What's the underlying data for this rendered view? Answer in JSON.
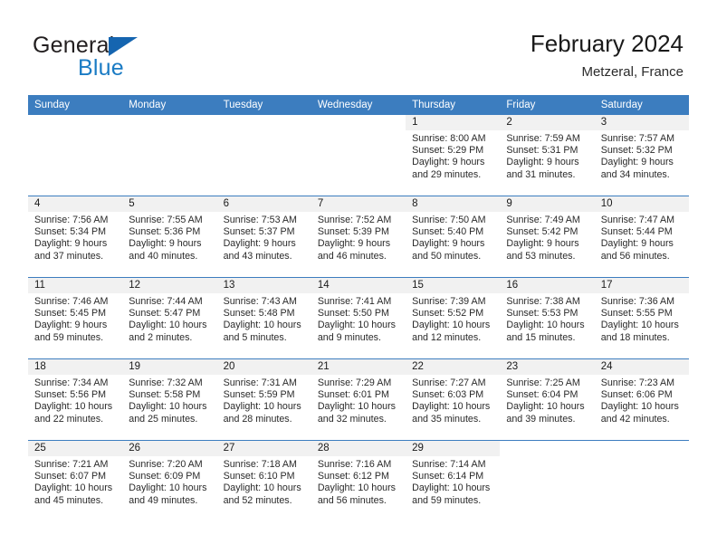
{
  "brand": {
    "name_top": "General",
    "name_bottom": "Blue",
    "triangle_icon": "blue-triangle-logo-icon",
    "color_dark": "#231f20",
    "color_blue": "#1a7bc4"
  },
  "header": {
    "title": "February 2024",
    "subtitle": "Metzeral, France"
  },
  "theme": {
    "header_row_bg": "#3c7dbf",
    "daynum_band_bg": "#f1f1f1",
    "week_separator": "#3c7dbf",
    "text": "#2a2a2a"
  },
  "weekday_headers": [
    "Sunday",
    "Monday",
    "Tuesday",
    "Wednesday",
    "Thursday",
    "Friday",
    "Saturday"
  ],
  "weeks": [
    [
      {
        "day": "",
        "blank": true,
        "sunrise": "",
        "sunset": "",
        "daylight_line1": "",
        "daylight_line2": ""
      },
      {
        "day": "",
        "blank": true,
        "sunrise": "",
        "sunset": "",
        "daylight_line1": "",
        "daylight_line2": ""
      },
      {
        "day": "",
        "blank": true,
        "sunrise": "",
        "sunset": "",
        "daylight_line1": "",
        "daylight_line2": ""
      },
      {
        "day": "",
        "blank": true,
        "sunrise": "",
        "sunset": "",
        "daylight_line1": "",
        "daylight_line2": ""
      },
      {
        "day": "1",
        "blank": false,
        "sunrise": "Sunrise: 8:00 AM",
        "sunset": "Sunset: 5:29 PM",
        "daylight_line1": "Daylight: 9 hours",
        "daylight_line2": "and 29 minutes."
      },
      {
        "day": "2",
        "blank": false,
        "sunrise": "Sunrise: 7:59 AM",
        "sunset": "Sunset: 5:31 PM",
        "daylight_line1": "Daylight: 9 hours",
        "daylight_line2": "and 31 minutes."
      },
      {
        "day": "3",
        "blank": false,
        "sunrise": "Sunrise: 7:57 AM",
        "sunset": "Sunset: 5:32 PM",
        "daylight_line1": "Daylight: 9 hours",
        "daylight_line2": "and 34 minutes."
      }
    ],
    [
      {
        "day": "4",
        "blank": false,
        "sunrise": "Sunrise: 7:56 AM",
        "sunset": "Sunset: 5:34 PM",
        "daylight_line1": "Daylight: 9 hours",
        "daylight_line2": "and 37 minutes."
      },
      {
        "day": "5",
        "blank": false,
        "sunrise": "Sunrise: 7:55 AM",
        "sunset": "Sunset: 5:36 PM",
        "daylight_line1": "Daylight: 9 hours",
        "daylight_line2": "and 40 minutes."
      },
      {
        "day": "6",
        "blank": false,
        "sunrise": "Sunrise: 7:53 AM",
        "sunset": "Sunset: 5:37 PM",
        "daylight_line1": "Daylight: 9 hours",
        "daylight_line2": "and 43 minutes."
      },
      {
        "day": "7",
        "blank": false,
        "sunrise": "Sunrise: 7:52 AM",
        "sunset": "Sunset: 5:39 PM",
        "daylight_line1": "Daylight: 9 hours",
        "daylight_line2": "and 46 minutes."
      },
      {
        "day": "8",
        "blank": false,
        "sunrise": "Sunrise: 7:50 AM",
        "sunset": "Sunset: 5:40 PM",
        "daylight_line1": "Daylight: 9 hours",
        "daylight_line2": "and 50 minutes."
      },
      {
        "day": "9",
        "blank": false,
        "sunrise": "Sunrise: 7:49 AM",
        "sunset": "Sunset: 5:42 PM",
        "daylight_line1": "Daylight: 9 hours",
        "daylight_line2": "and 53 minutes."
      },
      {
        "day": "10",
        "blank": false,
        "sunrise": "Sunrise: 7:47 AM",
        "sunset": "Sunset: 5:44 PM",
        "daylight_line1": "Daylight: 9 hours",
        "daylight_line2": "and 56 minutes."
      }
    ],
    [
      {
        "day": "11",
        "blank": false,
        "sunrise": "Sunrise: 7:46 AM",
        "sunset": "Sunset: 5:45 PM",
        "daylight_line1": "Daylight: 9 hours",
        "daylight_line2": "and 59 minutes."
      },
      {
        "day": "12",
        "blank": false,
        "sunrise": "Sunrise: 7:44 AM",
        "sunset": "Sunset: 5:47 PM",
        "daylight_line1": "Daylight: 10 hours",
        "daylight_line2": "and 2 minutes."
      },
      {
        "day": "13",
        "blank": false,
        "sunrise": "Sunrise: 7:43 AM",
        "sunset": "Sunset: 5:48 PM",
        "daylight_line1": "Daylight: 10 hours",
        "daylight_line2": "and 5 minutes."
      },
      {
        "day": "14",
        "blank": false,
        "sunrise": "Sunrise: 7:41 AM",
        "sunset": "Sunset: 5:50 PM",
        "daylight_line1": "Daylight: 10 hours",
        "daylight_line2": "and 9 minutes."
      },
      {
        "day": "15",
        "blank": false,
        "sunrise": "Sunrise: 7:39 AM",
        "sunset": "Sunset: 5:52 PM",
        "daylight_line1": "Daylight: 10 hours",
        "daylight_line2": "and 12 minutes."
      },
      {
        "day": "16",
        "blank": false,
        "sunrise": "Sunrise: 7:38 AM",
        "sunset": "Sunset: 5:53 PM",
        "daylight_line1": "Daylight: 10 hours",
        "daylight_line2": "and 15 minutes."
      },
      {
        "day": "17",
        "blank": false,
        "sunrise": "Sunrise: 7:36 AM",
        "sunset": "Sunset: 5:55 PM",
        "daylight_line1": "Daylight: 10 hours",
        "daylight_line2": "and 18 minutes."
      }
    ],
    [
      {
        "day": "18",
        "blank": false,
        "sunrise": "Sunrise: 7:34 AM",
        "sunset": "Sunset: 5:56 PM",
        "daylight_line1": "Daylight: 10 hours",
        "daylight_line2": "and 22 minutes."
      },
      {
        "day": "19",
        "blank": false,
        "sunrise": "Sunrise: 7:32 AM",
        "sunset": "Sunset: 5:58 PM",
        "daylight_line1": "Daylight: 10 hours",
        "daylight_line2": "and 25 minutes."
      },
      {
        "day": "20",
        "blank": false,
        "sunrise": "Sunrise: 7:31 AM",
        "sunset": "Sunset: 5:59 PM",
        "daylight_line1": "Daylight: 10 hours",
        "daylight_line2": "and 28 minutes."
      },
      {
        "day": "21",
        "blank": false,
        "sunrise": "Sunrise: 7:29 AM",
        "sunset": "Sunset: 6:01 PM",
        "daylight_line1": "Daylight: 10 hours",
        "daylight_line2": "and 32 minutes."
      },
      {
        "day": "22",
        "blank": false,
        "sunrise": "Sunrise: 7:27 AM",
        "sunset": "Sunset: 6:03 PM",
        "daylight_line1": "Daylight: 10 hours",
        "daylight_line2": "and 35 minutes."
      },
      {
        "day": "23",
        "blank": false,
        "sunrise": "Sunrise: 7:25 AM",
        "sunset": "Sunset: 6:04 PM",
        "daylight_line1": "Daylight: 10 hours",
        "daylight_line2": "and 39 minutes."
      },
      {
        "day": "24",
        "blank": false,
        "sunrise": "Sunrise: 7:23 AM",
        "sunset": "Sunset: 6:06 PM",
        "daylight_line1": "Daylight: 10 hours",
        "daylight_line2": "and 42 minutes."
      }
    ],
    [
      {
        "day": "25",
        "blank": false,
        "sunrise": "Sunrise: 7:21 AM",
        "sunset": "Sunset: 6:07 PM",
        "daylight_line1": "Daylight: 10 hours",
        "daylight_line2": "and 45 minutes."
      },
      {
        "day": "26",
        "blank": false,
        "sunrise": "Sunrise: 7:20 AM",
        "sunset": "Sunset: 6:09 PM",
        "daylight_line1": "Daylight: 10 hours",
        "daylight_line2": "and 49 minutes."
      },
      {
        "day": "27",
        "blank": false,
        "sunrise": "Sunrise: 7:18 AM",
        "sunset": "Sunset: 6:10 PM",
        "daylight_line1": "Daylight: 10 hours",
        "daylight_line2": "and 52 minutes."
      },
      {
        "day": "28",
        "blank": false,
        "sunrise": "Sunrise: 7:16 AM",
        "sunset": "Sunset: 6:12 PM",
        "daylight_line1": "Daylight: 10 hours",
        "daylight_line2": "and 56 minutes."
      },
      {
        "day": "29",
        "blank": false,
        "sunrise": "Sunrise: 7:14 AM",
        "sunset": "Sunset: 6:14 PM",
        "daylight_line1": "Daylight: 10 hours",
        "daylight_line2": "and 59 minutes."
      },
      {
        "day": "",
        "blank": true,
        "sunrise": "",
        "sunset": "",
        "daylight_line1": "",
        "daylight_line2": ""
      },
      {
        "day": "",
        "blank": true,
        "sunrise": "",
        "sunset": "",
        "daylight_line1": "",
        "daylight_line2": ""
      }
    ]
  ]
}
